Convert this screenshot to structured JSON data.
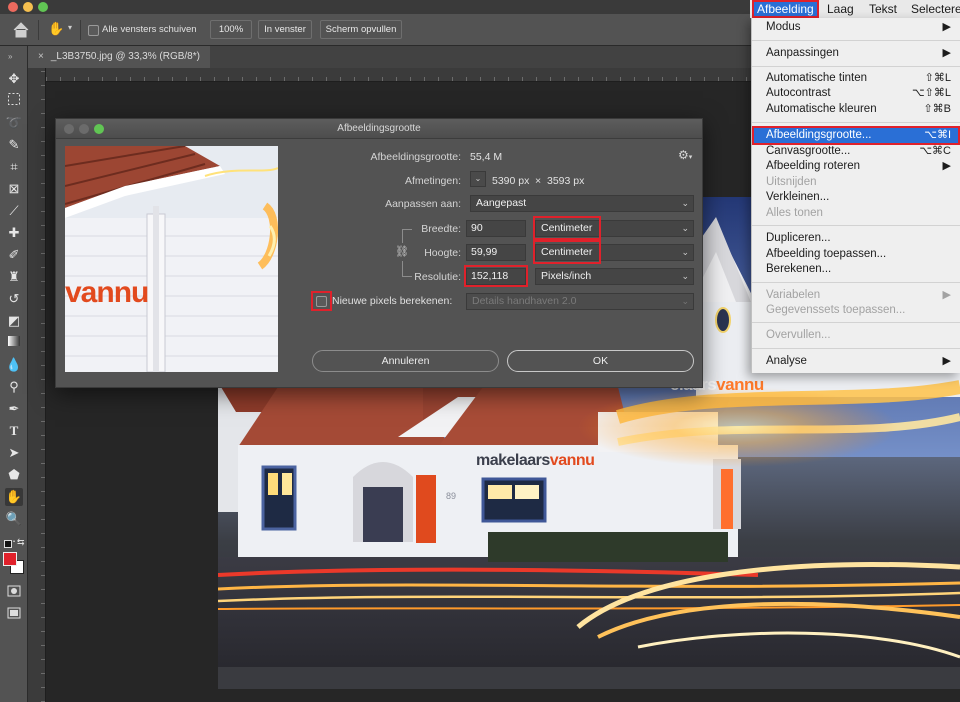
{
  "options_bar": {
    "scroll_all_windows_label": "Alle vensters schuiven",
    "zoom_100_label": "100%",
    "fit_screen_label": "In venster",
    "fill_screen_label": "Scherm opvullen"
  },
  "document_tab": {
    "title": "_L3B3750.jpg @ 33,3% (RGB/8*)"
  },
  "colors": {
    "foreground_swatch": "#e0212b",
    "annotation_red": "#e0212b",
    "menu_highlight": "#2a6fd6"
  },
  "menubar": {
    "items": [
      "Afbeelding",
      "Laag",
      "Tekst",
      "Selectere"
    ]
  },
  "image_menu": {
    "items": [
      {
        "label": "Modus",
        "shortcut": "",
        "submenu": true,
        "disabled": false
      },
      {
        "label": "Aanpassingen",
        "shortcut": "",
        "submenu": true,
        "disabled": false
      },
      {
        "label": "Automatische tinten",
        "shortcut": "⇧⌘L",
        "submenu": false,
        "disabled": false
      },
      {
        "label": "Autocontrast",
        "shortcut": "⌥⇧⌘L",
        "submenu": false,
        "disabled": false
      },
      {
        "label": "Automatische kleuren",
        "shortcut": "⇧⌘B",
        "submenu": false,
        "disabled": false
      },
      {
        "label": "Afbeeldingsgrootte...",
        "shortcut": "⌥⌘I",
        "submenu": false,
        "disabled": false,
        "selected": true
      },
      {
        "label": "Canvasgrootte...",
        "shortcut": "⌥⌘C",
        "submenu": false,
        "disabled": false
      },
      {
        "label": "Afbeelding roteren",
        "shortcut": "",
        "submenu": true,
        "disabled": false
      },
      {
        "label": "Uitsnijden",
        "shortcut": "",
        "submenu": false,
        "disabled": true
      },
      {
        "label": "Verkleinen...",
        "shortcut": "",
        "submenu": false,
        "disabled": false
      },
      {
        "label": "Alles tonen",
        "shortcut": "",
        "submenu": false,
        "disabled": true
      },
      {
        "label": "Dupliceren...",
        "shortcut": "",
        "submenu": false,
        "disabled": false
      },
      {
        "label": "Afbeelding toepassen...",
        "shortcut": "",
        "submenu": false,
        "disabled": false
      },
      {
        "label": "Berekenen...",
        "shortcut": "",
        "submenu": false,
        "disabled": false
      },
      {
        "label": "Variabelen",
        "shortcut": "",
        "submenu": true,
        "disabled": true
      },
      {
        "label": "Gegevenssets toepassen...",
        "shortcut": "",
        "submenu": false,
        "disabled": true
      },
      {
        "label": "Overvullen...",
        "shortcut": "",
        "submenu": false,
        "disabled": true
      },
      {
        "label": "Analyse",
        "shortcut": "",
        "submenu": true,
        "disabled": false
      }
    ]
  },
  "dialog": {
    "title": "Afbeeldingsgrootte",
    "image_size_label": "Afbeeldingsgrootte:",
    "image_size_value": "55,4 M",
    "dimensions_label": "Afmetingen:",
    "dimensions_width": "5390 px",
    "dimensions_times": "×",
    "dimensions_height": "3593 px",
    "fit_to_label": "Aanpassen aan:",
    "fit_to_value": "Aangepast",
    "width_label": "Breedte:",
    "width_value": "90",
    "width_unit": "Centimeter",
    "height_label": "Hoogte:",
    "height_value": "59,99",
    "height_unit": "Centimeter",
    "resolution_label": "Resolutie:",
    "resolution_value": "152,118",
    "resolution_unit": "Pixels/inch",
    "resample_label": "Nieuwe pixels berekenen:",
    "resample_checked": false,
    "resample_method": "Details handhaven 2.0",
    "cancel_label": "Annuleren",
    "ok_label": "OK"
  },
  "photo": {
    "sign_text": "makelaarsvannu",
    "sign_text_partial": "elaarsvannu",
    "sign_text_preview": "vannu",
    "house_number": "89"
  }
}
